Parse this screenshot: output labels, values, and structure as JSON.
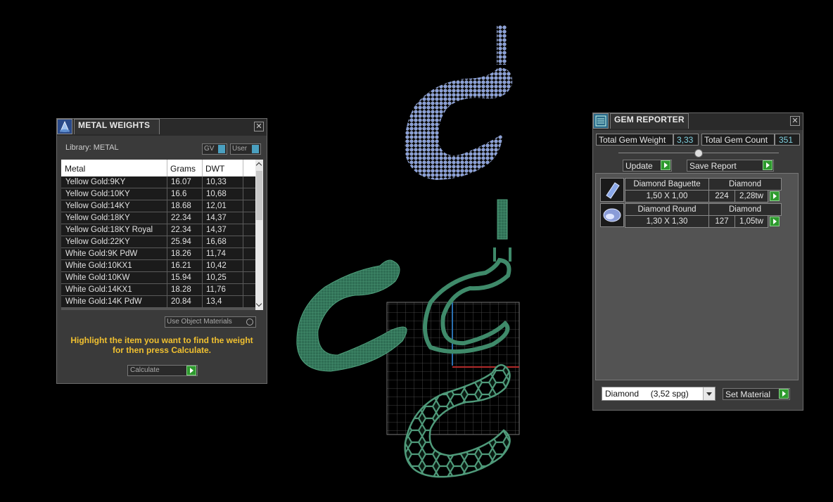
{
  "metal_weights": {
    "title": "METAL WEIGHTS",
    "library_label": "Library: METAL",
    "gv_label": "GV",
    "user_label": "User",
    "columns": [
      "Metal",
      "Grams",
      "DWT"
    ],
    "rows": [
      {
        "metal": "Yellow Gold:9KY",
        "grams": "16.07",
        "dwt": "10,33"
      },
      {
        "metal": "Yellow Gold:10KY",
        "grams": "16.6",
        "dwt": "10,68"
      },
      {
        "metal": "Yellow Gold:14KY",
        "grams": "18.68",
        "dwt": "12,01"
      },
      {
        "metal": "Yellow Gold:18KY",
        "grams": "22.34",
        "dwt": "14,37"
      },
      {
        "metal": "Yellow Gold:18KY Royal",
        "grams": "22.34",
        "dwt": "14,37"
      },
      {
        "metal": "Yellow Gold:22KY",
        "grams": "25.94",
        "dwt": "16,68"
      },
      {
        "metal": "White Gold:9K PdW",
        "grams": "18.26",
        "dwt": "11,74"
      },
      {
        "metal": "White Gold:10KX1",
        "grams": "16.21",
        "dwt": "10,42"
      },
      {
        "metal": "White Gold:10KW",
        "grams": "15.94",
        "dwt": "10,25"
      },
      {
        "metal": "White Gold:14KX1",
        "grams": "18.28",
        "dwt": "11,76"
      },
      {
        "metal": "White Gold:14K PdW",
        "grams": "20.84",
        "dwt": "13,4"
      }
    ],
    "use_object_materials_label": "Use Object Materials",
    "instruction": "Highlight the item you want to find the weight for then press Calculate.",
    "calculate_label": "Calculate",
    "accent_color": "#f0c030"
  },
  "gem_reporter": {
    "title": "GEM REPORTER",
    "total_gem_weight_label": "Total Gem Weight",
    "total_gem_weight_value": "3,33",
    "total_gem_count_label": "Total Gem Count",
    "total_gem_count_value": "351",
    "update_label": "Update",
    "save_report_label": "Save Report",
    "gems": [
      {
        "name": "Diamond Baguette",
        "material": "Diamond",
        "size": "1,50 X 1,00",
        "count": "224",
        "weight": "2,28tw",
        "icon": "baguette-gem-icon"
      },
      {
        "name": "Diamond Round",
        "material": "Diamond",
        "size": "1,30 X 1,30",
        "count": "127",
        "weight": "1,05tw",
        "icon": "round-gem-icon"
      }
    ],
    "material_select_value": "Diamond     (3,52 spg)",
    "set_material_label": "Set Material"
  },
  "viewport": {
    "rendered_model_color": "#8aa0d8",
    "wireframe_model_color": "#3f8a6a"
  }
}
